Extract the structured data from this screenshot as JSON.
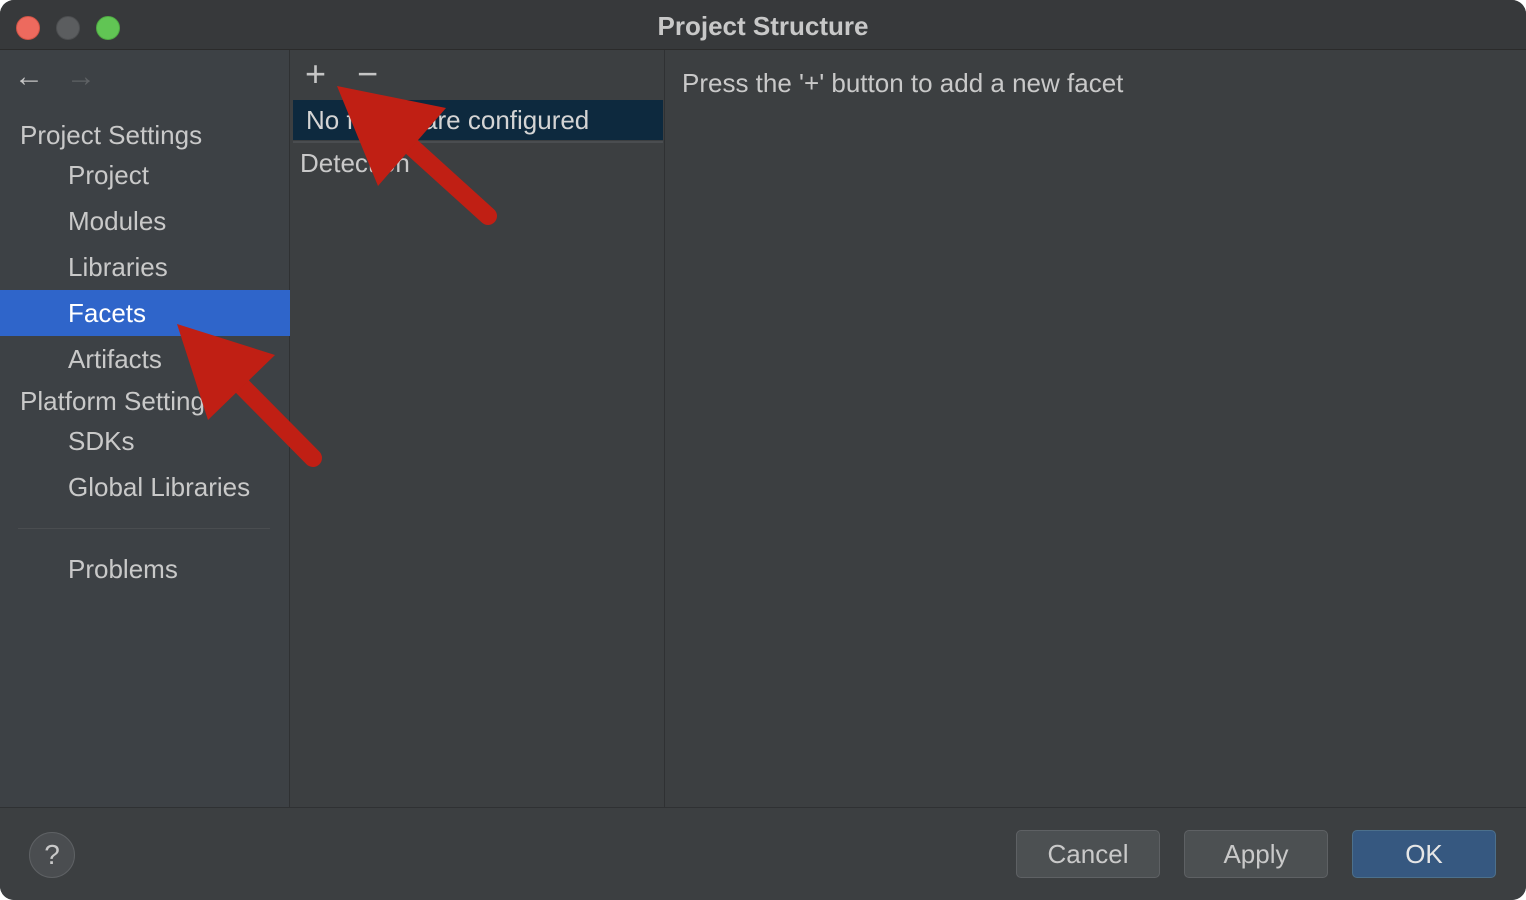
{
  "window": {
    "title": "Project Structure"
  },
  "nav": {
    "back_icon": "←",
    "forward_icon": "→"
  },
  "sidebar": {
    "project_settings_header": "Project Settings",
    "project_items": [
      {
        "label": "Project"
      },
      {
        "label": "Modules"
      },
      {
        "label": "Libraries"
      },
      {
        "label": "Facets",
        "selected": true
      },
      {
        "label": "Artifacts"
      }
    ],
    "platform_settings_header": "Platform Settings",
    "platform_items": [
      {
        "label": "SDKs"
      },
      {
        "label": "Global Libraries"
      }
    ],
    "problems_label": "Problems"
  },
  "middle": {
    "add_icon": "+",
    "remove_icon": "−",
    "empty_row": "No facets are configured",
    "detection_label": "Detection"
  },
  "right": {
    "hint": "Press the '+' button to add a new facet"
  },
  "bottom": {
    "help_label": "?",
    "cancel_label": "Cancel",
    "apply_label": "Apply",
    "ok_label": "OK"
  },
  "colors": {
    "window_bg": "#3c3f41",
    "selection": "#2f65ca",
    "facet_row_bg": "#0d293e",
    "ok_button": "#365880",
    "annotation_arrow": "#c01f14"
  }
}
